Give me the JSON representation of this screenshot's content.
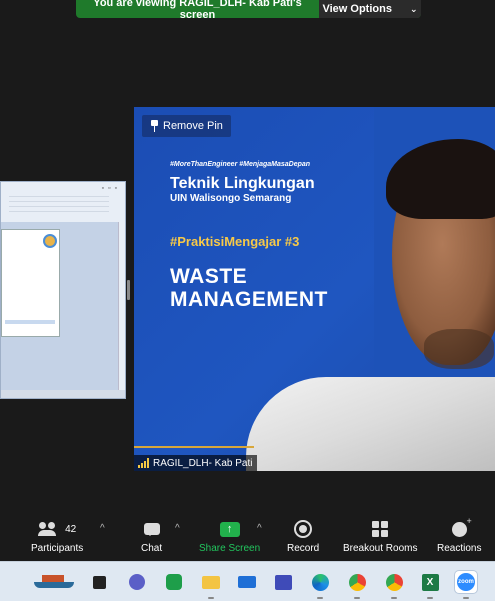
{
  "banner": {
    "viewing_text": "You are viewing RAGIL_DLH- Kab Pati's screen",
    "view_options_label": "View Options"
  },
  "video": {
    "remove_pin_label": "Remove Pin",
    "participant_name": "RAGIL_DLH- Kab Pati",
    "slide": {
      "hashtags": "#MoreThanEngineer #MenjagaMasaDepan",
      "title": "Teknik Lingkungan",
      "subtitle": "UIN Walisongo Semarang",
      "series": "#PraktisiMengajar #3",
      "topic_line1": "WASTE",
      "topic_line2": "MANAGEMENT"
    }
  },
  "toolbar": {
    "participants_label": "Participants",
    "participants_count": "42",
    "chat_label": "Chat",
    "share_label": "Share Screen",
    "record_label": "Record",
    "breakout_label": "Breakout Rooms",
    "reactions_label": "Reactions",
    "accent_green": "#22b14c"
  },
  "taskbar": {
    "apps": [
      "ship-wallpaper-icon",
      "app-icon",
      "teams-icon",
      "feedback-icon",
      "file-explorer-icon",
      "mail-icon",
      "azure-icon",
      "edge-icon",
      "chrome-icon",
      "chrome-profile-icon",
      "excel-icon",
      "zoom-icon"
    ],
    "zoom_icon_label": "zoom"
  }
}
